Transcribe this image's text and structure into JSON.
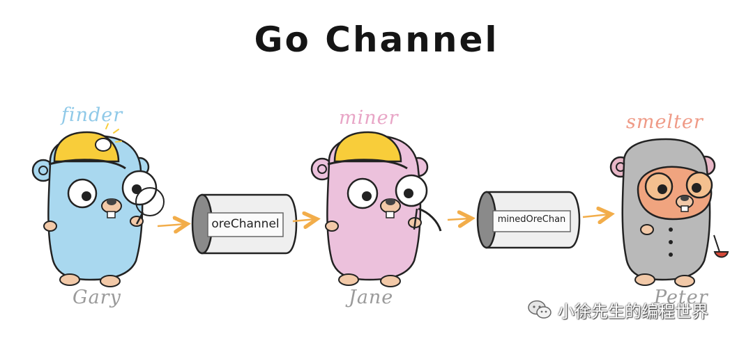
{
  "title": "Go Channel",
  "workers": [
    {
      "role": "finder",
      "name": "Gary",
      "role_color": "#8fc9e8",
      "body_color": "#a9d8ef"
    },
    {
      "role": "miner",
      "name": "Jane",
      "role_color": "#e8a5c6",
      "body_color": "#ecc1dc"
    },
    {
      "role": "smelter",
      "name": "Peter",
      "role_color": "#ef9a86",
      "body_color": "#b9b9b9"
    }
  ],
  "channels": [
    {
      "label": "oreChannel"
    },
    {
      "label": "minedOreChan"
    }
  ],
  "watermark": {
    "text": "小徐先生的编程世界",
    "icon": "wechat-icon"
  },
  "colors": {
    "arrow": "#f2ad4a",
    "helmet": "#f8cd3a",
    "outline": "#222222"
  }
}
